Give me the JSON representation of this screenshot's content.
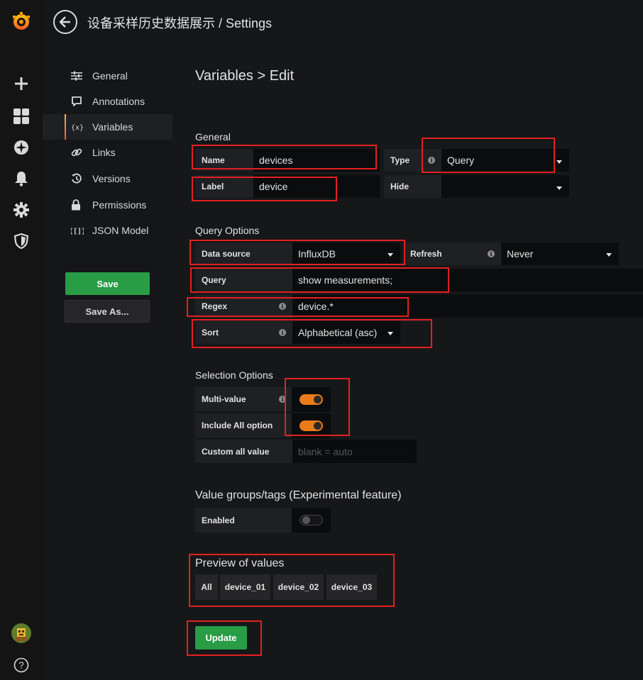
{
  "header": {
    "title": "设备采样历史数据展示 / Settings"
  },
  "sidemenu": {
    "icons": [
      "grafana-logo-icon",
      "plus-icon",
      "dashboards-icon",
      "explore-icon",
      "bell-icon",
      "gear-icon",
      "shield-icon",
      "avatar",
      "help-icon"
    ]
  },
  "nav": {
    "items": [
      {
        "label": "General",
        "icon": "sliders-icon"
      },
      {
        "label": "Annotations",
        "icon": "comment-icon"
      },
      {
        "label": "Variables",
        "icon": "variable-icon"
      },
      {
        "label": "Links",
        "icon": "link-icon"
      },
      {
        "label": "Versions",
        "icon": "history-icon"
      },
      {
        "label": "Permissions",
        "icon": "lock-icon"
      },
      {
        "label": "JSON Model",
        "icon": "json-icon"
      }
    ],
    "active": "Variables",
    "save_label": "Save",
    "save_as_label": "Save As..."
  },
  "editor": {
    "title": "Variables > Edit",
    "general": {
      "heading": "General",
      "name_label": "Name",
      "name_value": "devices",
      "type_label": "Type",
      "type_value": "Query",
      "label_label": "Label",
      "label_value": "device",
      "hide_label": "Hide",
      "hide_value": ""
    },
    "query_options": {
      "heading": "Query Options",
      "datasource_label": "Data source",
      "datasource_value": "InfluxDB",
      "refresh_label": "Refresh",
      "refresh_value": "Never",
      "query_label": "Query",
      "query_value": "show measurements;",
      "regex_label": "Regex",
      "regex_value": "device.*",
      "sort_label": "Sort",
      "sort_value": "Alphabetical (asc)"
    },
    "selection_options": {
      "heading": "Selection Options",
      "multi_label": "Multi-value",
      "multi_enabled": true,
      "include_all_label": "Include All option",
      "include_all_enabled": true,
      "custom_all_label": "Custom all value",
      "custom_all_placeholder": "blank = auto"
    },
    "value_groups": {
      "heading": "Value groups/tags (Experimental feature)",
      "enabled_label": "Enabled",
      "enabled": false
    },
    "preview": {
      "heading": "Preview of values",
      "values": [
        "All",
        "device_01",
        "device_02",
        "device_03"
      ]
    },
    "update_label": "Update"
  },
  "colors": {
    "accent": "#eb7b18",
    "primary_button": "#299c46",
    "highlight": "#e32020"
  }
}
